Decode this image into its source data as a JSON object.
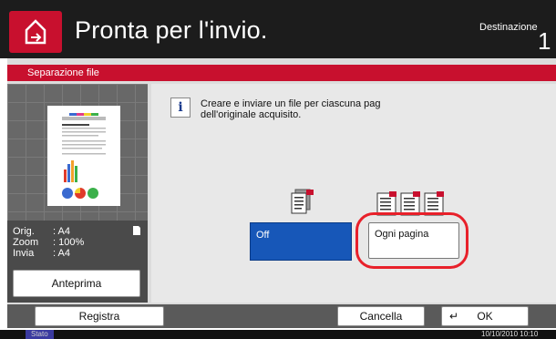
{
  "header": {
    "title": "Pronta per l'invio.",
    "destination_label": "Destinazione",
    "destination_count": "1",
    "home_icon": "home-send-icon"
  },
  "section": {
    "title": "Separazione file"
  },
  "preview": {
    "info": [
      {
        "key": "Orig.",
        "value": ": A4"
      },
      {
        "key": "Zoom",
        "value": ": 100%"
      },
      {
        "key": "Invia",
        "value": ": A4"
      }
    ],
    "preview_button": "Anteprima"
  },
  "message": {
    "icon": "info-icon",
    "line1": "Creare e inviare un file per ciascuna pag",
    "line2": "dell'originale acquisito."
  },
  "options": {
    "off_label": "Off",
    "every_page_label": "Ogni pagina",
    "selected": "Off"
  },
  "footer": {
    "register_label": "Registra",
    "cancel_label": "Cancella",
    "ok_label": "OK"
  },
  "status": {
    "stato_label": "Stato",
    "datetime": "10/10/2010 10:10"
  },
  "colors": {
    "brand_red": "#c8102e",
    "selected_blue": "#1757b8",
    "highlight": "#e8202a"
  }
}
